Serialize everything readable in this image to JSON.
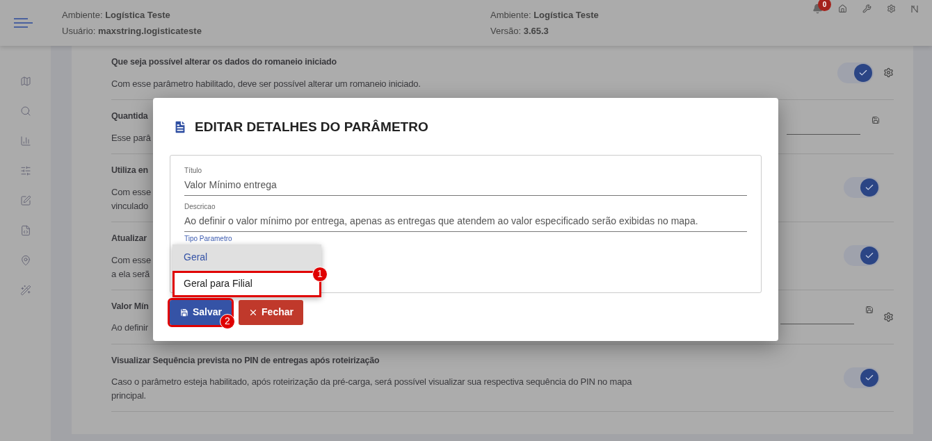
{
  "header": {
    "left": [
      "Ambiente: **Logística Teste**",
      "Usuário: **maxstring.logisticateste**"
    ],
    "right": [
      "Ambiente: **Logística Teste**",
      "Versão: **3.65.3**"
    ],
    "notifications": "0"
  },
  "sidebar": {
    "items": [
      {
        "kind": "map"
      },
      {
        "kind": "search"
      },
      {
        "kind": "chart"
      },
      {
        "kind": "sliders"
      },
      {
        "kind": "edit"
      },
      {
        "kind": "code"
      },
      {
        "kind": "pin"
      },
      {
        "kind": "wand"
      }
    ]
  },
  "parameters": [
    {
      "title": "Que seja possível alterar os dados do romaneio iniciado",
      "description": [
        "Com esse parâmetro habilitado, deve ser possível alterar um romaneio iniciado."
      ],
      "kind": "toggle",
      "on": true,
      "settings": true
    },
    {
      "title": "Quantida",
      "description": [
        "Esse parâ"
      ],
      "kind": "input",
      "settings": false
    },
    {
      "title": "Utiliza en",
      "description": [
        "Com esse",
        "vinculado"
      ],
      "kind": "toggle",
      "on": true,
      "settings": false
    },
    {
      "title": "Atualizar",
      "description": [
        "Com esse",
        "a ela serã"
      ],
      "kind": "toggle",
      "on": true,
      "settings": false
    },
    {
      "title": "Valor Mín",
      "description": [
        "Ao definir"
      ],
      "kind": "input",
      "settings": true
    },
    {
      "title": "Visualizar Sequência prevista no PIN de entregas após roteirização",
      "description": [
        "Caso o parâmetro esteja habilitado, após roteirização da pré-carga, será possível visualizar sua respectiva sequência do PIN no mapa",
        "principal."
      ],
      "kind": "toggle",
      "on": true,
      "settings": false
    }
  ],
  "dialog": {
    "title": "EDITAR DETALHES DO PARÂMETRO",
    "fields": [
      {
        "label": "Título",
        "value": "Valor Mínimo entrega"
      },
      {
        "label": "Descricao",
        "value": "Ao definir o valor mínimo por entrega, apenas as entregas que atendem ao valor especificado serão exibidas no mapa."
      }
    ],
    "select": {
      "label": "Tipo Parametro",
      "options": [
        {
          "label": "Geral",
          "selected": true
        },
        {
          "label": "Geral para Filial",
          "selected": false,
          "annotation": "1"
        }
      ]
    },
    "buttons": [
      {
        "kind": "save",
        "label": "Salvar",
        "annotation": "2"
      },
      {
        "kind": "close",
        "label": "Fechar"
      }
    ]
  }
}
